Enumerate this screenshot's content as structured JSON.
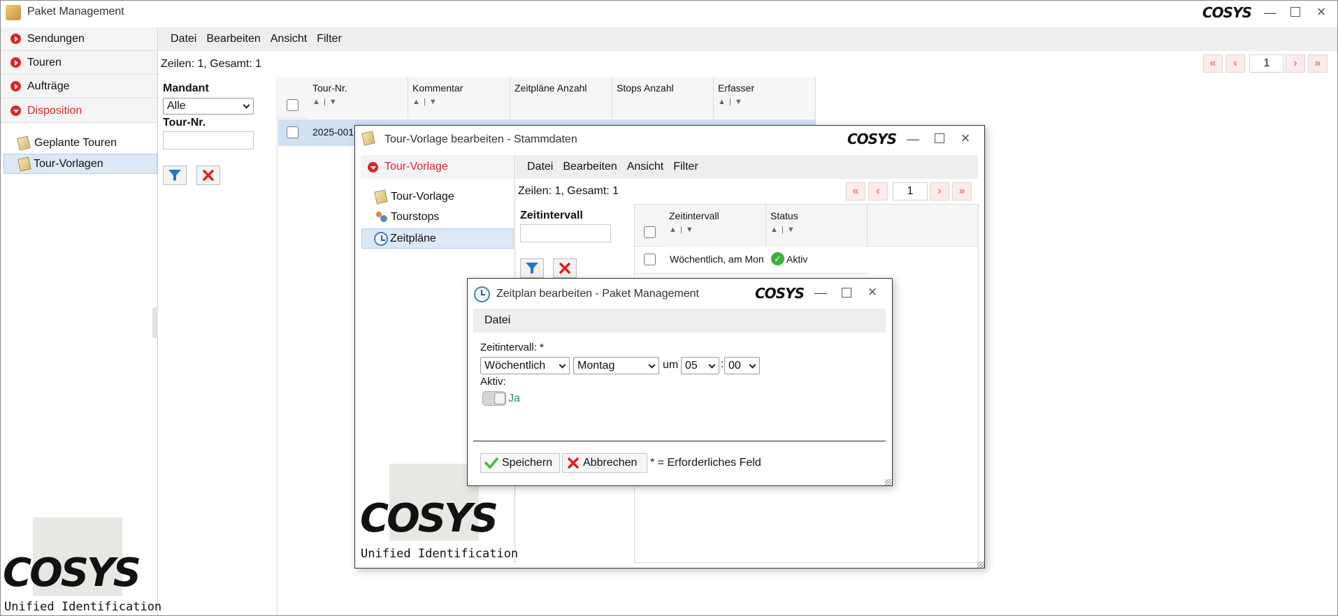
{
  "app": {
    "title": "Paket Management",
    "logo_text": "COSYS",
    "logo_sub": "Unified Identification"
  },
  "sidebar": {
    "items": [
      {
        "label": "Sendungen"
      },
      {
        "label": "Touren"
      },
      {
        "label": "Aufträge"
      },
      {
        "label": "Disposition"
      }
    ],
    "sub_items": [
      {
        "label": "Geplante Touren"
      },
      {
        "label": "Tour-Vorlagen"
      }
    ]
  },
  "main": {
    "menu": [
      "Datei",
      "Bearbeiten",
      "Ansicht",
      "Filter"
    ],
    "rows_info": "Zeilen: 1, Gesamt: 1",
    "page": "1",
    "filter": {
      "mandant_label": "Mandant",
      "mandant_value": "Alle",
      "tour_nr_label": "Tour-Nr."
    },
    "table": {
      "columns": [
        "Tour-Nr.",
        "Kommentar",
        "Zeitpläne Anzahl",
        "Stops Anzahl",
        "Erfasser"
      ],
      "rows": [
        {
          "tour_nr": "2025-001"
        }
      ]
    }
  },
  "tour_dialog": {
    "title": "Tour-Vorlage bearbeiten - Stammdaten",
    "nav_header": "Tour-Vorlage",
    "nav_items": [
      "Tour-Vorlage",
      "Tourstops",
      "Zeitpläne"
    ],
    "menu": [
      "Datei",
      "Bearbeiten",
      "Ansicht",
      "Filter"
    ],
    "rows_info": "Zeilen: 1, Gesamt: 1",
    "page": "1",
    "filter_label": "Zeitintervall",
    "table": {
      "columns": [
        "Zeitintervall",
        "Status"
      ],
      "rows": [
        {
          "interval": "Wöchentlich, am Mon",
          "status": "Aktiv"
        }
      ]
    }
  },
  "schedule_dialog": {
    "title": "Zeitplan bearbeiten - Paket Management",
    "menu": [
      "Datei"
    ],
    "interval_label": "Zeitintervall: *",
    "interval_value": "Wöchentlich",
    "day_value": "Montag",
    "um_label": "um",
    "hour_value": "05",
    "colon": ":",
    "minute_value": "00",
    "active_label": "Aktiv:",
    "active_value": "Ja",
    "save_label": "Speichern",
    "cancel_label": "Abbrechen",
    "required_note": "* = Erforderliches Feld"
  },
  "colors": {
    "accent_red": "#d9262c",
    "selected_row": "#cfe0f4",
    "status_green": "#3cae3c"
  }
}
